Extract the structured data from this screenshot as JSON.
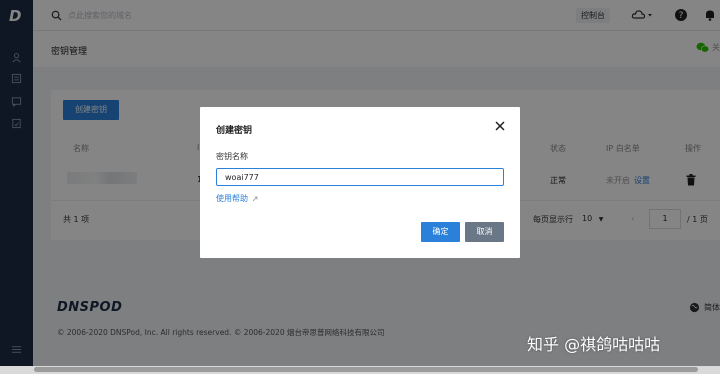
{
  "app": {
    "logo_letter": "D",
    "search_placeholder": "点此搜索您的域名",
    "console_label": "控制台",
    "wechat_partial": "关"
  },
  "page": {
    "title": "密钥管理",
    "create_button": "创建密钥",
    "columns": [
      "名称",
      "I",
      "状态",
      "IP 白名单",
      "操作"
    ],
    "row": {
      "col2_partial": "1",
      "status": "正常",
      "ip_whitelist": "未开启",
      "ip_setting": "设置"
    },
    "total_text": "共 1 项",
    "per_page_label": "每页显示行",
    "per_page_value": "10",
    "page_prev": "‹",
    "page_current": "1",
    "page_total": "/ 1 页"
  },
  "footer": {
    "logo_text": "DNSPOD",
    "copyright": "© 2006-2020 DNSPod, Inc. All rights reserved. © 2006-2020 烟台帝思普网络科技有限公司",
    "language_partial": "简体"
  },
  "modal": {
    "title": "创建密钥",
    "field_label": "密钥名称",
    "field_value": "woai777",
    "help_link": "使用帮助",
    "confirm_label": "确定",
    "cancel_label": "取消"
  },
  "watermark": "知乎 @祺鸽咕咕咕",
  "colors": {
    "primary": "#2b80d9",
    "sidebar": "#1d2b45",
    "cancel": "#6a7787"
  }
}
